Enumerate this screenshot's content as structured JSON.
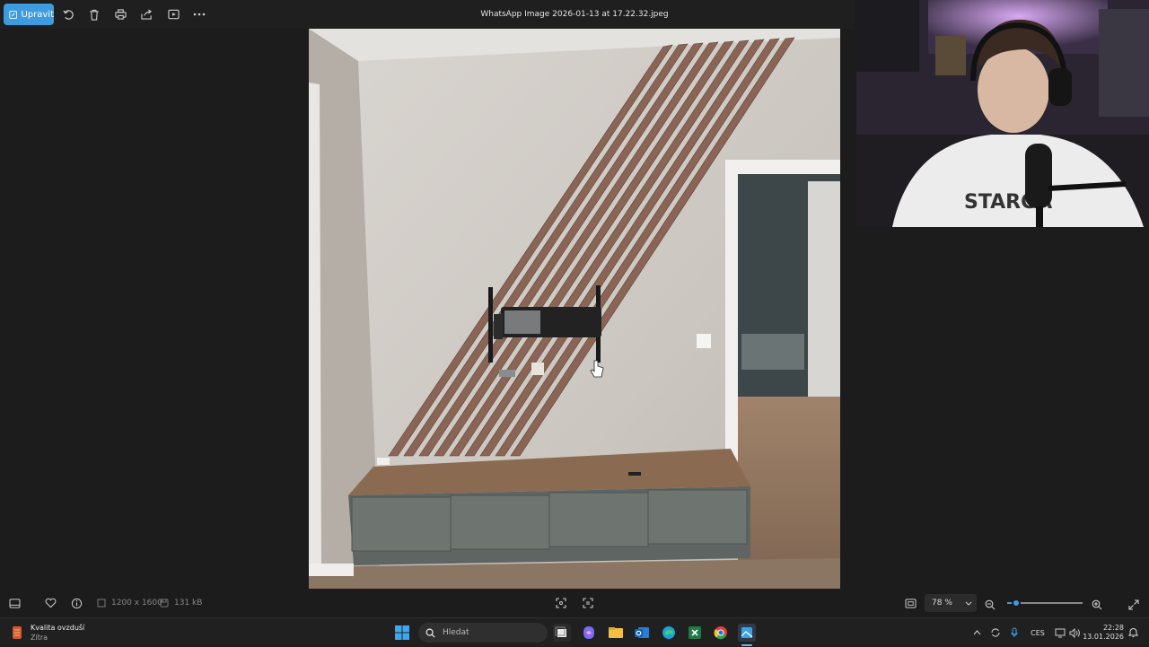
{
  "toolbar": {
    "edit_label": "Upravit",
    "file_name": "WhatsApp Image 2026-01-13 at 17.22.32.jpeg"
  },
  "status": {
    "dimensions": "1200 x 1600",
    "file_size": "131 kB",
    "zoom_label": "78 %",
    "zoom_percent": 78,
    "zoom_slider_fraction": 0.12
  },
  "taskbar": {
    "widget_title": "Kvalita ovzduší",
    "widget_subtitle": "Zítra",
    "search_placeholder": "Hledat",
    "language": "CES",
    "time": "22:28",
    "date": "13.01.2026"
  },
  "colors": {
    "accent": "#3d9bdf",
    "background": "#1c1c1c",
    "slat": "#8a6556",
    "cabinet_top": "#8b6a52",
    "cabinet_front": "#6e7470"
  }
}
